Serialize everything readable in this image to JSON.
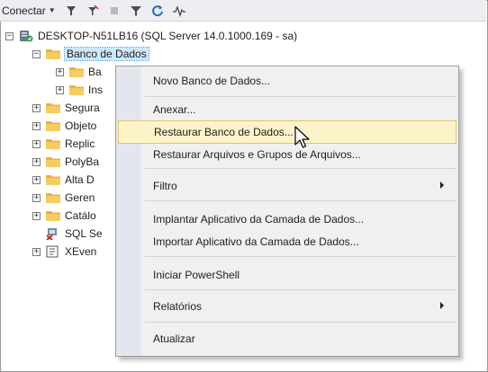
{
  "toolbar": {
    "connect_label": "Conectar",
    "icons": [
      "connect-filter-icon",
      "disconnect-icon",
      "stop-icon",
      "filter-icon",
      "refresh-icon",
      "activity-monitor-icon"
    ]
  },
  "tree": {
    "server": "DESKTOP-N51LB16 (SQL Server 14.0.1000.169 - sa)",
    "databases": "Banco de Dados",
    "db_children": [
      "Ba",
      "Ins"
    ],
    "items": [
      "Segura",
      "Objeto",
      "Replic",
      "PolyBa",
      "Alta D",
      "Geren",
      "Catálo",
      "SQL Se",
      "XEven"
    ]
  },
  "menu": {
    "items": [
      "Novo Banco de Dados...",
      "Anexar...",
      "Restaurar Banco de Dados...",
      "Restaurar Arquivos e Grupos de Arquivos...",
      "Filtro",
      "Implantar Aplicativo da Camada de Dados...",
      "Importar Aplicativo da Camada de Dados...",
      "Iniciar PowerShell",
      "Relatórios",
      "Atualizar"
    ],
    "highlighted": "Restaurar Banco de Dados..."
  },
  "colors": {
    "menu_highlight": "#fcf4c8",
    "menu_highlight_border": "#e5c365",
    "folder": "#e8b440",
    "selection": "#cce8ff"
  }
}
